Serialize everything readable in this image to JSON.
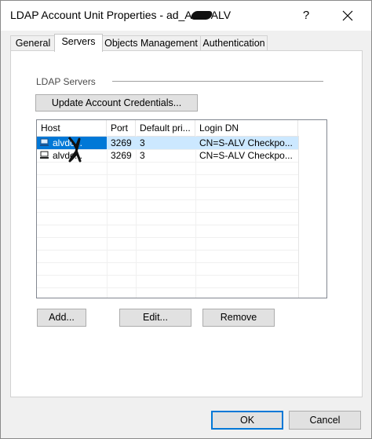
{
  "window": {
    "title_prefix": "LDAP Account Unit Properties - ad_A",
    "title_suffix": "ALV",
    "help_glyph": "?",
    "close_glyph": "✕"
  },
  "tabs": [
    {
      "label": "General"
    },
    {
      "label": "Servers"
    },
    {
      "label": "Objects Management"
    },
    {
      "label": "Authentication"
    }
  ],
  "servers_group": {
    "label": "LDAP Servers",
    "update_button": "Update Account Credentials..."
  },
  "table": {
    "columns": [
      "Host",
      "Port",
      "Default pri...",
      "Login DN"
    ],
    "rows": [
      {
        "host": "alvdc...",
        "port": "3269",
        "priority": "3",
        "login_dn": "CN=S-ALV Checkpo...",
        "icon": "computer-icon",
        "selected": true
      },
      {
        "host": "alvdc...",
        "port": "3269",
        "priority": "3",
        "login_dn": "CN=S-ALV Checkpo...",
        "icon": "computer-icon",
        "selected": false
      }
    ]
  },
  "actions": {
    "add": "Add...",
    "edit": "Edit...",
    "remove": "Remove"
  },
  "footer": {
    "ok": "OK",
    "cancel": "Cancel"
  },
  "colors": {
    "selection": "#cce8ff",
    "selection_focus": "#0078d7",
    "default_button_border": "#0078d7"
  }
}
